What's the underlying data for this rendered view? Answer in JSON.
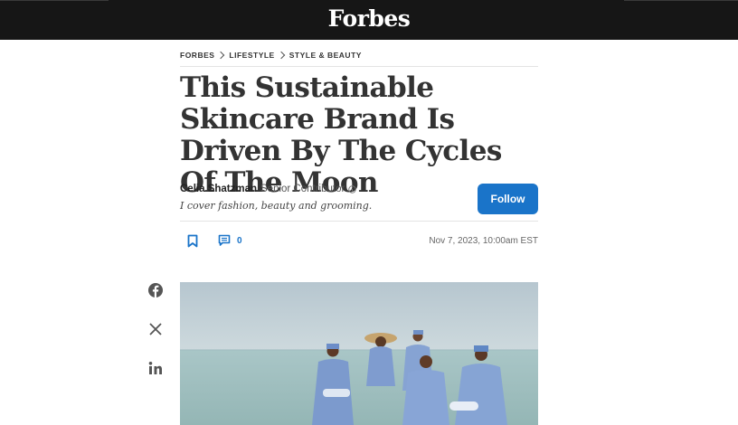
{
  "brand": {
    "logo_text": "Forbes"
  },
  "breadcrumb": [
    "FORBES",
    "LIFESTYLE",
    "STYLE & BEAUTY"
  ],
  "article": {
    "headline": "This Sustainable Skincare Brand Is Driven By The Cycles Of The Moon",
    "author": {
      "name": "Celia Shatzman",
      "role": "Senior Contributor",
      "bio": "I cover fashion, beauty and grooming."
    },
    "follow_label": "Follow",
    "comment_count": "0",
    "date": "Nov 7, 2023, 10:00am EST"
  },
  "share_icons": [
    "facebook-icon",
    "x-icon",
    "linkedin-icon"
  ],
  "colors": {
    "accent": "#1a74c9",
    "topbar": "#161616",
    "headline": "#333333"
  }
}
